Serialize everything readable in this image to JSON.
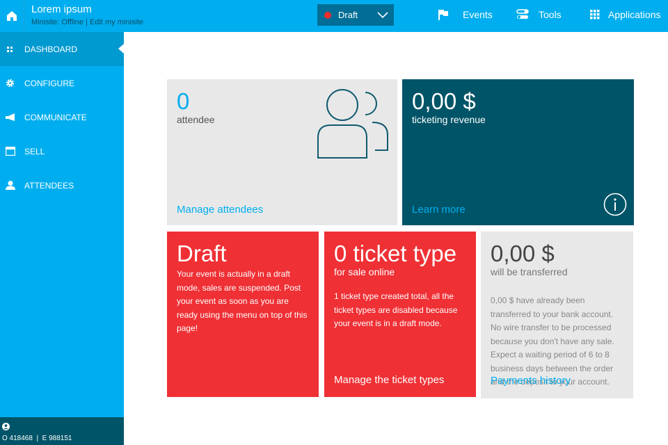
{
  "header": {
    "title": "Lorem ipsum",
    "minisite_status": "Minisite: Offline",
    "separator": "|",
    "edit_link": "Edit my minisite",
    "status_select": "Draft",
    "nav": [
      {
        "label": "Events",
        "icon": "flag-icon"
      },
      {
        "label": "Tools",
        "icon": "toggles-icon"
      },
      {
        "label": "Applications",
        "icon": "grid-icon"
      }
    ]
  },
  "sidebar": {
    "items": [
      {
        "label": "DASHBOARD",
        "icon": "dashboard-icon",
        "active": true
      },
      {
        "label": "CONFIGURE",
        "icon": "gear-icon"
      },
      {
        "label": "COMMUNICATE",
        "icon": "megaphone-icon"
      },
      {
        "label": "SELL",
        "icon": "store-icon"
      },
      {
        "label": "ATTENDEES",
        "icon": "user-icon"
      }
    ],
    "footer": {
      "ids": "O 418468  |  E 988151"
    }
  },
  "cards": {
    "attendees": {
      "value": "0",
      "label": "attendee",
      "link": "Manage attendees"
    },
    "revenue": {
      "value": "0,00 $",
      "label": "ticketing revenue",
      "link": "Learn more"
    },
    "draft": {
      "title": "Draft",
      "text": "Your event is actually in a draft mode, sales are suspended. Post your event as soon as you are ready using the menu on top of this page!"
    },
    "tickets": {
      "title": "0 ticket type",
      "label": "for sale online",
      "text": "1 ticket type created total, all the ticket types are disabled because your event is in a draft mode.",
      "link": "Manage the ticket types"
    },
    "transfer": {
      "value": "0,00 $",
      "label": "will be transferred",
      "text": "0,00 $ have already been transferred to your bank account. No wire transfer to be processed because you don't have any sale. Expect a waiting period of 6 to 8 business days between the order and the deposit to your account.",
      "link": "Payments history"
    }
  },
  "colors": {
    "primary": "#00aeef",
    "dark": "#005468",
    "red": "#ef3035",
    "grey": "#e8e8e8"
  }
}
